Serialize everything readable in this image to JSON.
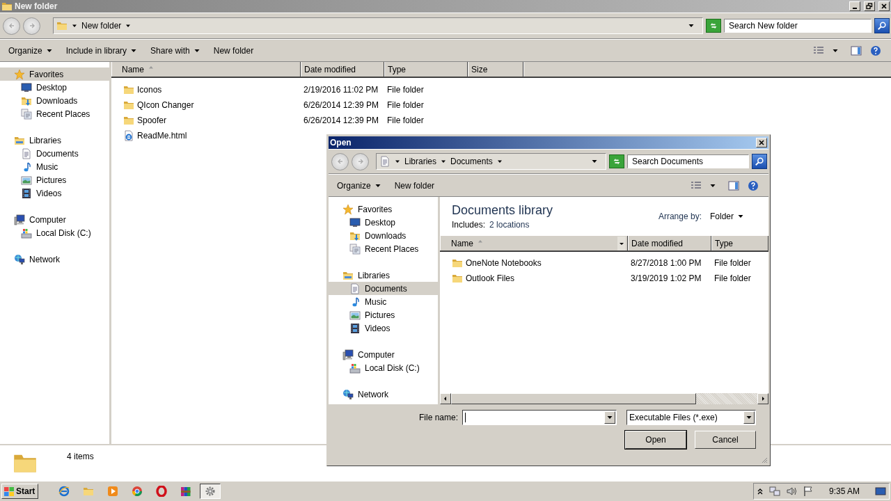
{
  "explorer": {
    "title": "New folder",
    "address": [
      "New folder"
    ],
    "search": {
      "placeholder": "Search New folder"
    },
    "commands": [
      {
        "label": "Organize",
        "dropdown": true
      },
      {
        "label": "Include in library",
        "dropdown": true
      },
      {
        "label": "Share with",
        "dropdown": true
      },
      {
        "label": "New folder",
        "dropdown": false
      }
    ],
    "nav": [
      {
        "label": "Favorites",
        "kind": "star",
        "selected": true,
        "children": [
          {
            "label": "Desktop",
            "kind": "desktop",
            "selected": false
          },
          {
            "label": "Downloads",
            "kind": "downloads",
            "selected": false
          },
          {
            "label": "Recent Places",
            "kind": "recent",
            "selected": false
          }
        ]
      },
      {
        "label": "Libraries",
        "kind": "libraries",
        "selected": false,
        "children": [
          {
            "label": "Documents",
            "kind": "documents",
            "selected": false
          },
          {
            "label": "Music",
            "kind": "music",
            "selected": false
          },
          {
            "label": "Pictures",
            "kind": "pictures",
            "selected": false
          },
          {
            "label": "Videos",
            "kind": "videos",
            "selected": false
          }
        ]
      },
      {
        "label": "Computer",
        "kind": "computer",
        "selected": false,
        "children": [
          {
            "label": "Local Disk (C:)",
            "kind": "disk",
            "selected": false
          }
        ]
      },
      {
        "label": "Network",
        "kind": "network",
        "selected": false
      }
    ],
    "columns": [
      {
        "label": "Name",
        "sorted": true
      },
      {
        "label": "Date modified",
        "sorted": false
      },
      {
        "label": "Type",
        "sorted": false
      },
      {
        "label": "Size",
        "sorted": false
      }
    ],
    "rows": [
      {
        "kind": "folder",
        "name": "Iconos",
        "date": "2/19/2016 11:02 PM",
        "type": "File folder"
      },
      {
        "kind": "folder",
        "name": "QIcon Changer",
        "date": "6/26/2014 12:39 PM",
        "type": "File folder"
      },
      {
        "kind": "folder",
        "name": "Spoofer",
        "date": "6/26/2014 12:39 PM",
        "type": "File folder"
      },
      {
        "kind": "html",
        "name": "ReadMe.html"
      }
    ],
    "status": "4 items"
  },
  "dialog": {
    "title": "Open",
    "address": [
      "Libraries",
      "Documents"
    ],
    "search": {
      "placeholder": "Search Documents"
    },
    "commands": [
      {
        "label": "Organize",
        "dropdown": true
      },
      {
        "label": "New folder",
        "dropdown": false
      }
    ],
    "nav": [
      {
        "label": "Favorites",
        "kind": "star",
        "selected": false,
        "children": [
          {
            "label": "Desktop",
            "kind": "desktop",
            "selected": false
          },
          {
            "label": "Downloads",
            "kind": "downloads",
            "selected": false
          },
          {
            "label": "Recent Places",
            "kind": "recent",
            "selected": false
          }
        ]
      },
      {
        "label": "Libraries",
        "kind": "libraries",
        "selected": false,
        "children": [
          {
            "label": "Documents",
            "kind": "documents",
            "selected": true
          },
          {
            "label": "Music",
            "kind": "music",
            "selected": false
          },
          {
            "label": "Pictures",
            "kind": "pictures",
            "selected": false
          },
          {
            "label": "Videos",
            "kind": "videos",
            "selected": false
          }
        ]
      },
      {
        "label": "Computer",
        "kind": "computer",
        "selected": false,
        "children": [
          {
            "label": "Local Disk (C:)",
            "kind": "disk",
            "selected": false
          }
        ]
      },
      {
        "label": "Network",
        "kind": "network",
        "selected": false
      }
    ],
    "library_title": "Documents library",
    "includes_label": "Includes:",
    "locations_link": "2 locations",
    "arrange_label": "Arrange by:",
    "arrange_value": "Folder",
    "columns": [
      {
        "label": "Name",
        "sorted": true
      },
      {
        "label": "Date modified",
        "sorted": false
      },
      {
        "label": "Type",
        "sorted": false
      }
    ],
    "rows": [
      {
        "kind": "folder",
        "name": "OneNote Notebooks",
        "date": "8/27/2018 1:00 PM",
        "type": "File folder"
      },
      {
        "kind": "folder",
        "name": "Outlook Files",
        "date": "3/19/2019 1:02 PM",
        "type": "File folder"
      }
    ],
    "file_name_label": "File name:",
    "file_type": "Executable Files (*.exe)",
    "buttons": [
      "Open",
      "Cancel"
    ]
  },
  "taskbar": {
    "start": "Start",
    "apps": [
      {
        "kind": "ie",
        "selected": false
      },
      {
        "kind": "explorer",
        "selected": false
      },
      {
        "kind": "media",
        "selected": false
      },
      {
        "kind": "chrome",
        "selected": false
      },
      {
        "kind": "opera",
        "selected": false
      },
      {
        "kind": "winrar",
        "selected": false
      },
      {
        "kind": "gear",
        "selected": true
      }
    ],
    "clock": "9:35 AM"
  }
}
